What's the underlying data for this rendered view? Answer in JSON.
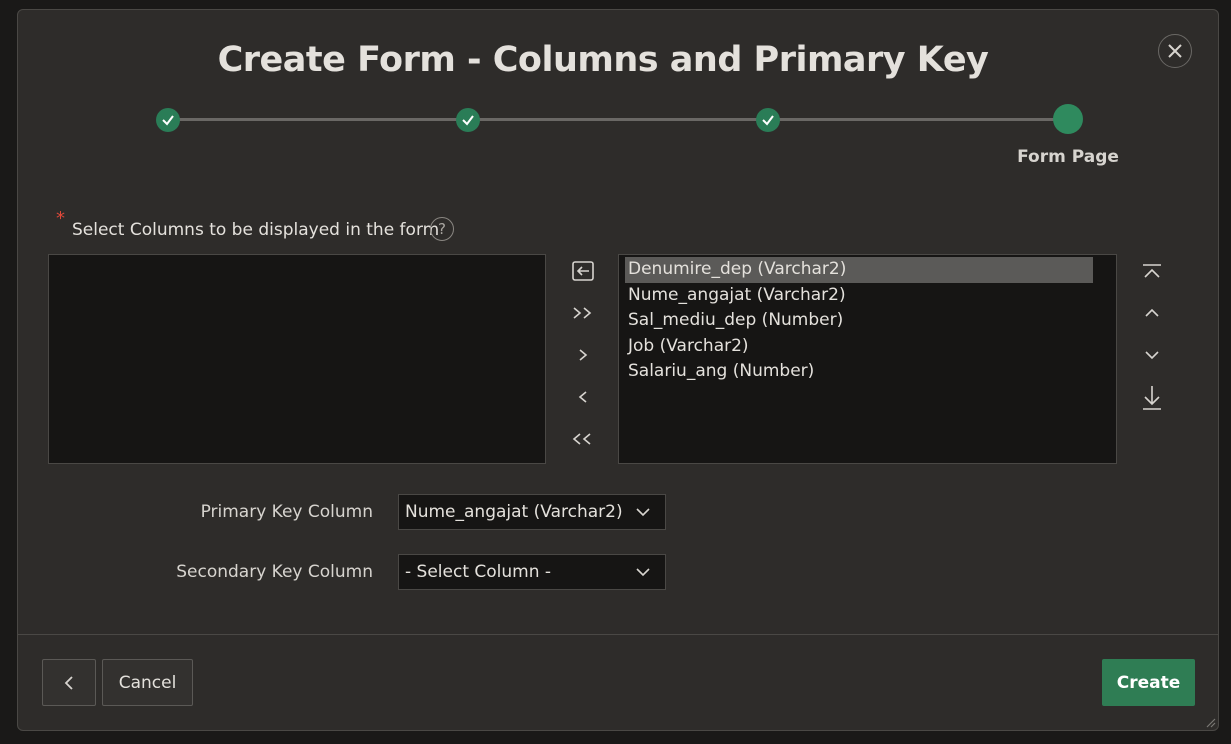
{
  "dialog": {
    "title": "Create Form - Columns and Primary Key",
    "close_icon": "close-icon"
  },
  "wizard": {
    "current_step_label": "Form Page",
    "steps": [
      {
        "status": "complete",
        "icon": "check-icon"
      },
      {
        "status": "complete",
        "icon": "check-icon"
      },
      {
        "status": "complete",
        "icon": "check-icon"
      },
      {
        "status": "current"
      }
    ],
    "complete_color": "#2a7d57"
  },
  "columns": {
    "label": "Select Columns to be displayed in the form",
    "required_marker": "*",
    "help_icon": "?",
    "available": [],
    "selected": [
      "Denumire_dep (Varchar2)",
      "Nume_angajat (Varchar2)",
      "Sal_mediu_dep (Number)",
      "Job (Varchar2)",
      "Salariu_ang (Number)"
    ],
    "highlighted_index": 0,
    "shuttle_controls": [
      "reset-icon",
      "move-all-icon",
      "move-icon",
      "remove-icon",
      "remove-all-icon"
    ],
    "order_controls": [
      "move-top-icon",
      "move-up-icon",
      "move-down-icon",
      "move-bottom-icon"
    ]
  },
  "primary_key": {
    "label": "Primary Key Column",
    "value": "Nume_angajat (Varchar2)"
  },
  "secondary_key": {
    "label": "Secondary Key Column",
    "value": "- Select Column -"
  },
  "footer": {
    "back_icon": "chevron-left-icon",
    "cancel_label": "Cancel",
    "create_label": "Create",
    "create_color": "#2f7d54"
  }
}
